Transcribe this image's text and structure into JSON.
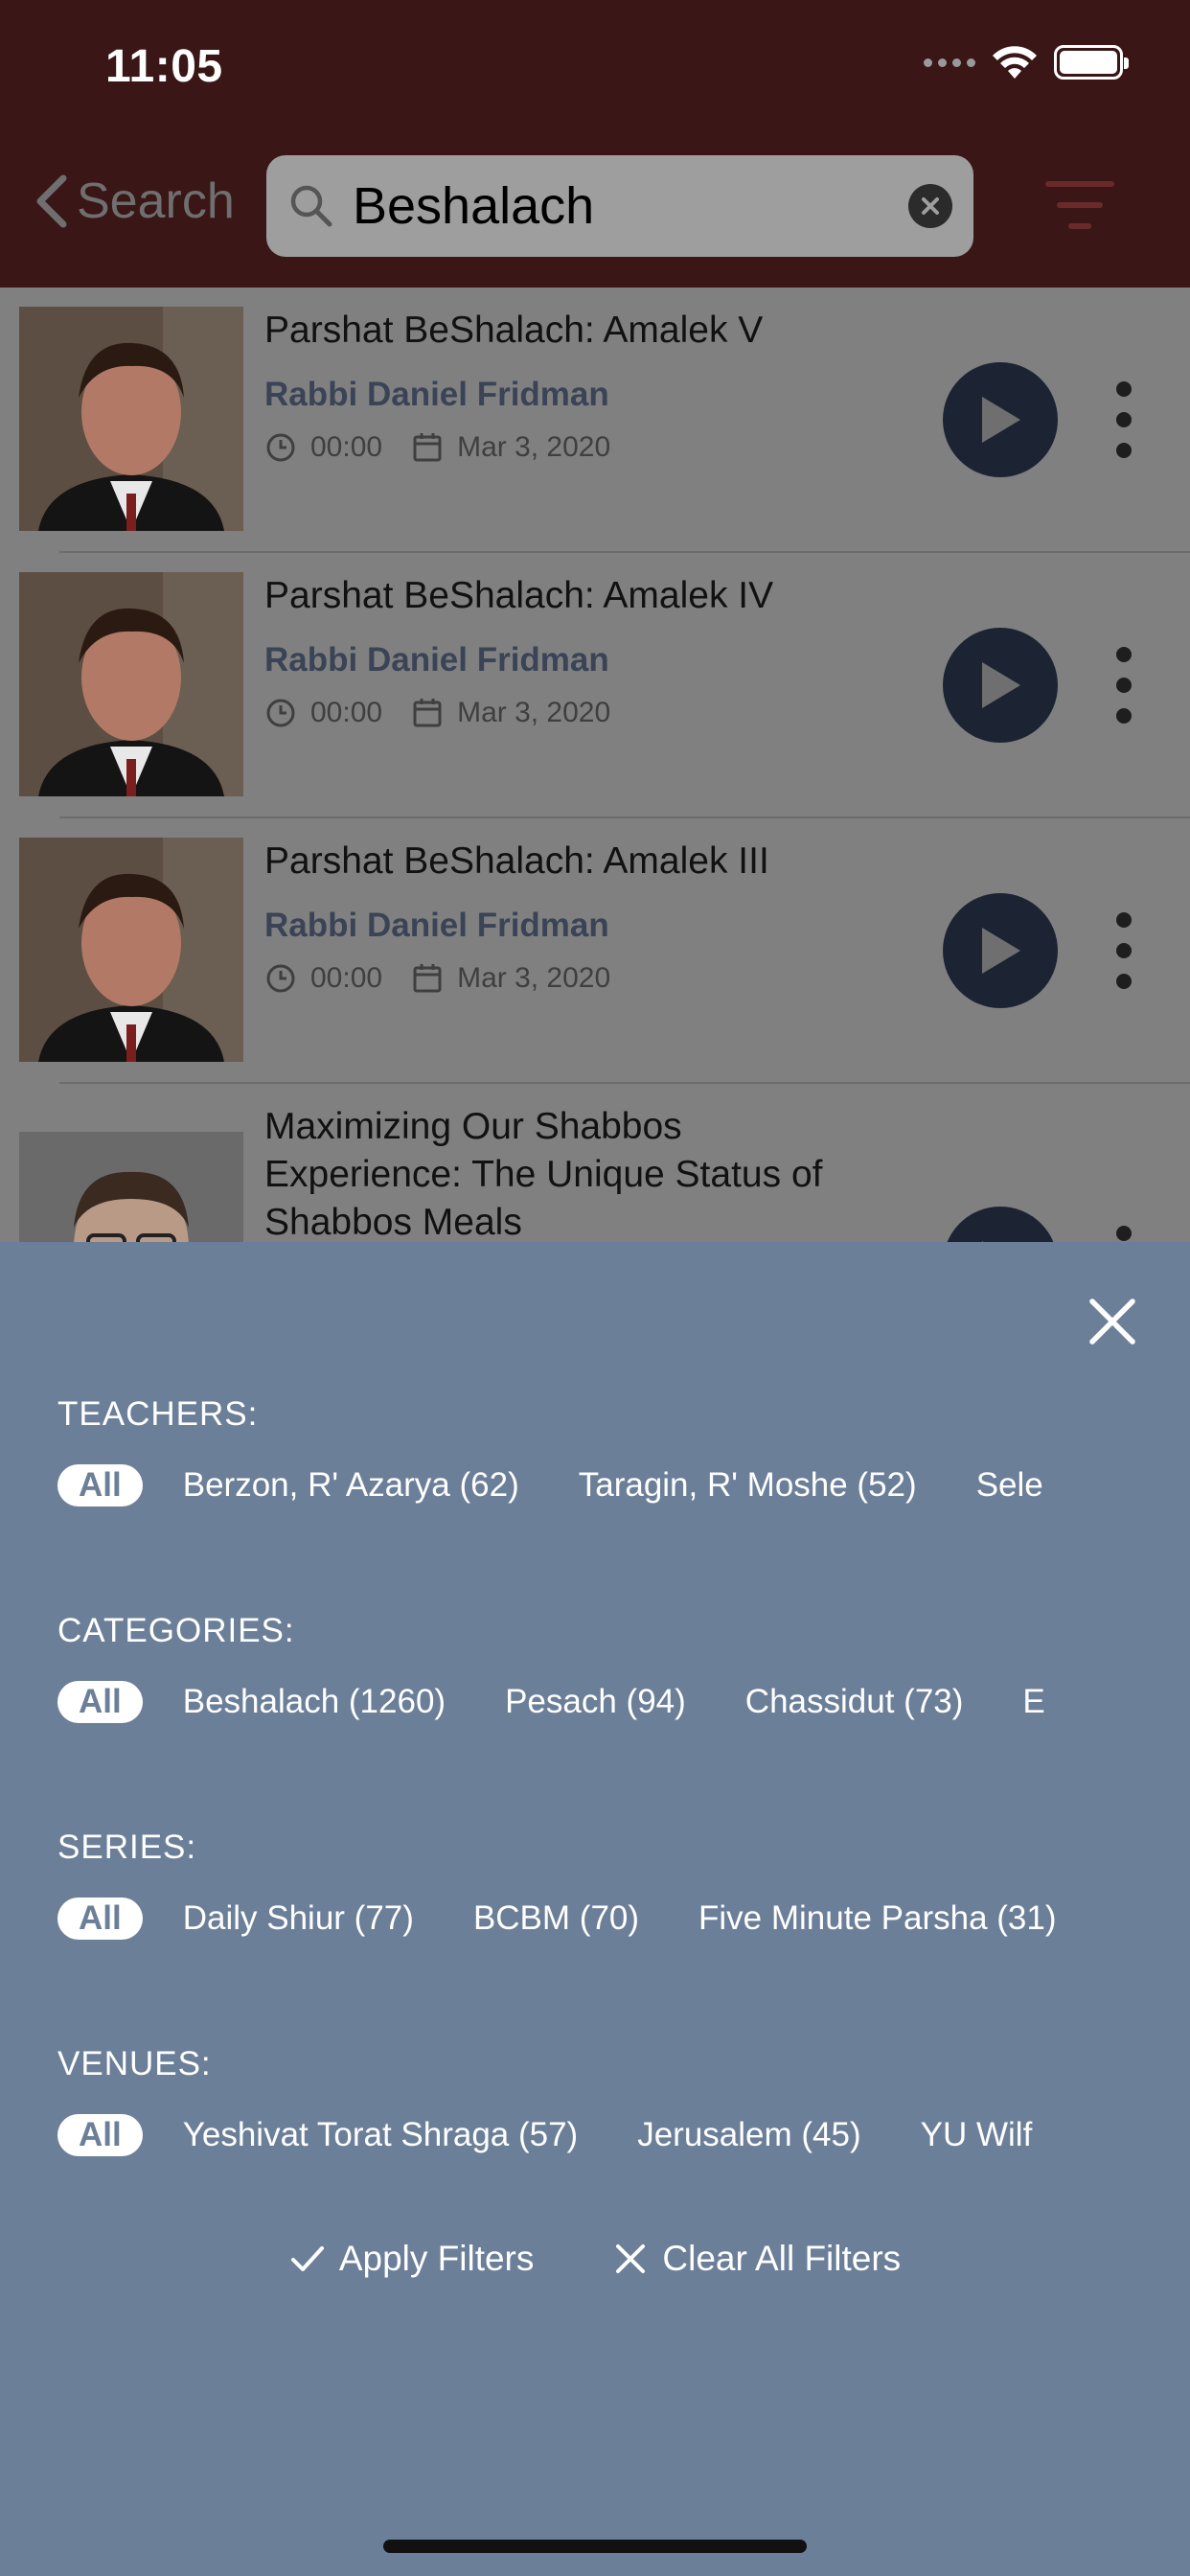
{
  "status_bar": {
    "time": "11:05"
  },
  "nav": {
    "back_label": "Search",
    "search_value": "Beshalach",
    "search_placeholder": "Search"
  },
  "results": [
    {
      "title": "Parshat BeShalach: Amalek V",
      "teacher": "Rabbi Daniel Fridman",
      "duration": "00:00",
      "date": "Mar 3, 2020"
    },
    {
      "title": "Parshat BeShalach: Amalek IV",
      "teacher": "Rabbi Daniel Fridman",
      "duration": "00:00",
      "date": "Mar 3, 2020"
    },
    {
      "title": "Parshat BeShalach: Amalek III",
      "teacher": "Rabbi Daniel Fridman",
      "duration": "00:00",
      "date": "Mar 3, 2020"
    },
    {
      "title": "Maximizing Our Shabbos Experience: The Unique Status of Shabbos Meals"
    }
  ],
  "filters": {
    "teachers": {
      "label": "TEACHERS:",
      "options": [
        "All",
        "Berzon, R' Azarya (62)",
        "Taragin, R' Moshe (52)",
        "Sele"
      ]
    },
    "categories": {
      "label": "CATEGORIES:",
      "options": [
        "All",
        "Beshalach (1260)",
        "Pesach (94)",
        "Chassidut (73)",
        "E"
      ]
    },
    "series": {
      "label": "SERIES:",
      "options": [
        "All",
        "Daily Shiur (77)",
        "BCBM (70)",
        "Five Minute Parsha (31)"
      ]
    },
    "venues": {
      "label": "VENUES:",
      "options": [
        "All",
        "Yeshivat Torat Shraga (57)",
        "Jerusalem (45)",
        "YU Wilf"
      ]
    },
    "apply_label": "Apply Filters",
    "clear_label": "Clear All Filters"
  },
  "colors": {
    "topbar": "#3a1616",
    "sheet": "#6c7f99",
    "play": "#1c2433",
    "teacher_text": "#3a4456"
  }
}
